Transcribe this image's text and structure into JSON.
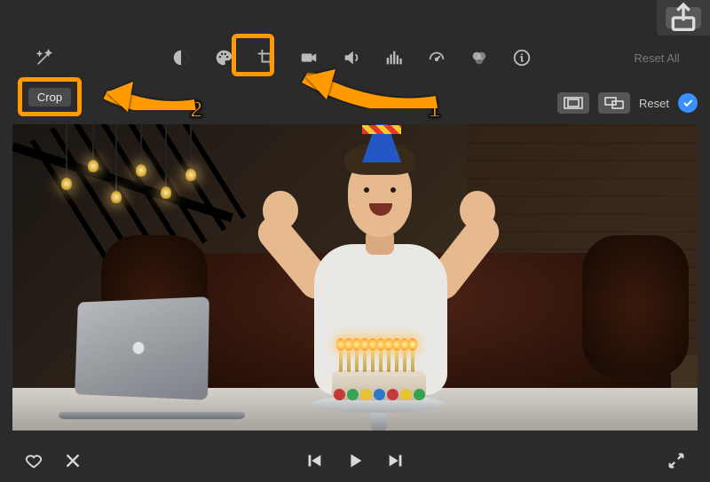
{
  "share": {
    "name": "share"
  },
  "toolbar": {
    "enhance": "Auto Enhance",
    "balance": "Color Balance",
    "palette": "Color Correction",
    "crop_tool": "Crop",
    "camera": "Stabilization",
    "volume": "Volume",
    "eq": "Noise Reduction/Equalizer",
    "speed": "Speed",
    "filters": "Clip Filter",
    "info": "Info",
    "reset_all": "Reset All"
  },
  "crop_row": {
    "button_label": "Crop",
    "fit": "Fit",
    "kenburns": "Ken Burns",
    "reset": "Reset"
  },
  "annotations": {
    "step1": "1",
    "step2": "2"
  },
  "playback": {
    "favorite": "Favorite",
    "reject": "Reject",
    "prev": "Previous Frame",
    "play": "Play",
    "next": "Next Frame",
    "fullscreen": "Fullscreen"
  }
}
